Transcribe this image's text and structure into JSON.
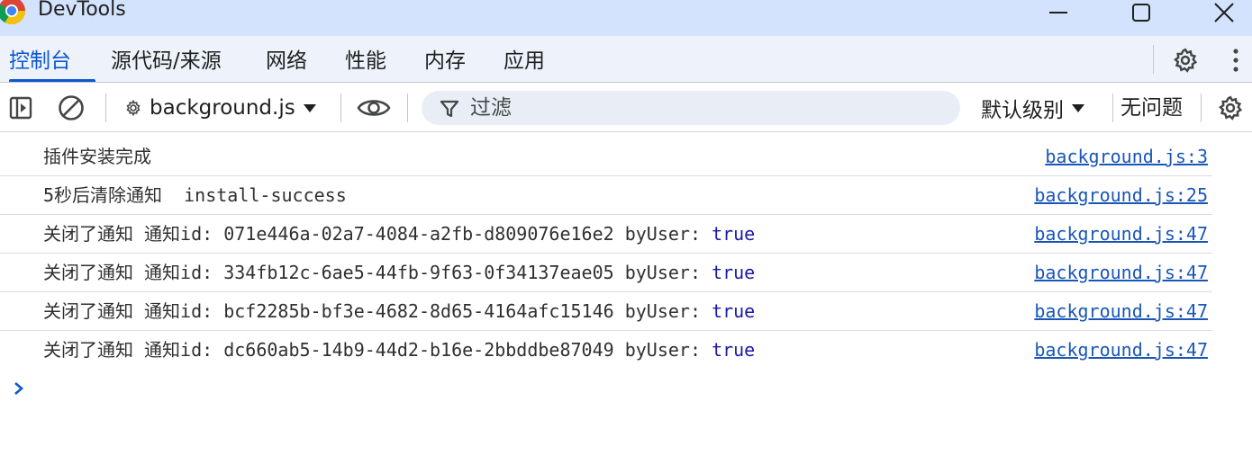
{
  "window": {
    "title": "DevTools"
  },
  "tabs": [
    {
      "label": "控制台",
      "active": true
    },
    {
      "label": "源代码/来源",
      "active": false
    },
    {
      "label": "网络",
      "active": false
    },
    {
      "label": "性能",
      "active": false
    },
    {
      "label": "内存",
      "active": false
    },
    {
      "label": "应用",
      "active": false
    }
  ],
  "toolbar": {
    "context": "background.js",
    "filter_placeholder": "过滤",
    "levels": "默认级别",
    "issues": "无问题"
  },
  "messages": [
    {
      "parts": [
        "插件安装完成"
      ],
      "source": "background.js:3"
    },
    {
      "parts": [
        "5秒后清除通知  install-success"
      ],
      "source": "background.js:25"
    },
    {
      "parts": [
        "关闭了通知 通知id: 071e446a-02a7-4084-a2fb-d809076e16e2 byUser: ",
        "true"
      ],
      "source": "background.js:47"
    },
    {
      "parts": [
        "关闭了通知 通知id: 334fb12c-6ae5-44fb-9f63-0f34137eae05 byUser: ",
        "true"
      ],
      "source": "background.js:47"
    },
    {
      "parts": [
        "关闭了通知 通知id: bcf2285b-bf3e-4682-8d65-4164afc15146 byUser: ",
        "true"
      ],
      "source": "background.js:47"
    },
    {
      "parts": [
        "关闭了通知 通知id: dc660ab5-14b9-44d2-b16e-2bbddbe87049 byUser: ",
        "true"
      ],
      "source": "background.js:47"
    }
  ],
  "icons": {
    "window": [
      "chrome-logo-icon",
      "minimize-icon",
      "maximize-icon",
      "close-icon"
    ],
    "toolbar": [
      "sidebar-toggle-icon",
      "clear-console-icon",
      "gear-small-icon",
      "dropdown-arrow-icon",
      "eye-icon",
      "filter-icon",
      "settings-gear-icon",
      "kebab-menu-icon"
    ]
  },
  "colors": {
    "titlebar_bg": "#d3e3fd",
    "tabbar_bg": "#eef3fb",
    "accent": "#0b57d0",
    "link": "#1a56b8",
    "boolean_value": "#1a1aa6"
  }
}
